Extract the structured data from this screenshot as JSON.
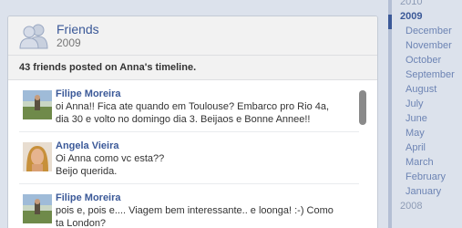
{
  "card": {
    "title": "Friends",
    "subtitle": "2009",
    "summary": "43 friends posted on Anna's timeline."
  },
  "posts": [
    {
      "author": "Filipe Moreira",
      "message": "oi Anna!! Fica ate quando em Toulouse? Embarco pro Rio 4a,\ndia 30 e volto no domingo dia 3. Beijaos e Bonne Annee!!"
    },
    {
      "author": "Angela Vieira",
      "message": "Oi Anna como vc esta??\nBeijo querida."
    },
    {
      "author": "Filipe Moreira",
      "message": "pois e, pois e.... Viagem bem interessante.. e loonga! :-) Como\nta London?"
    }
  ],
  "timeline": {
    "prev_year": "2010",
    "active_year": "2009",
    "months": [
      "December",
      "November",
      "October",
      "September",
      "August",
      "July",
      "June",
      "May",
      "April",
      "March",
      "February",
      "January"
    ],
    "next_year": "2008"
  },
  "colors": {
    "link": "#3b5998",
    "timeline_month": "#6d84b4",
    "background": "#dce2ec"
  },
  "icons": {
    "header": "friends-icon"
  }
}
